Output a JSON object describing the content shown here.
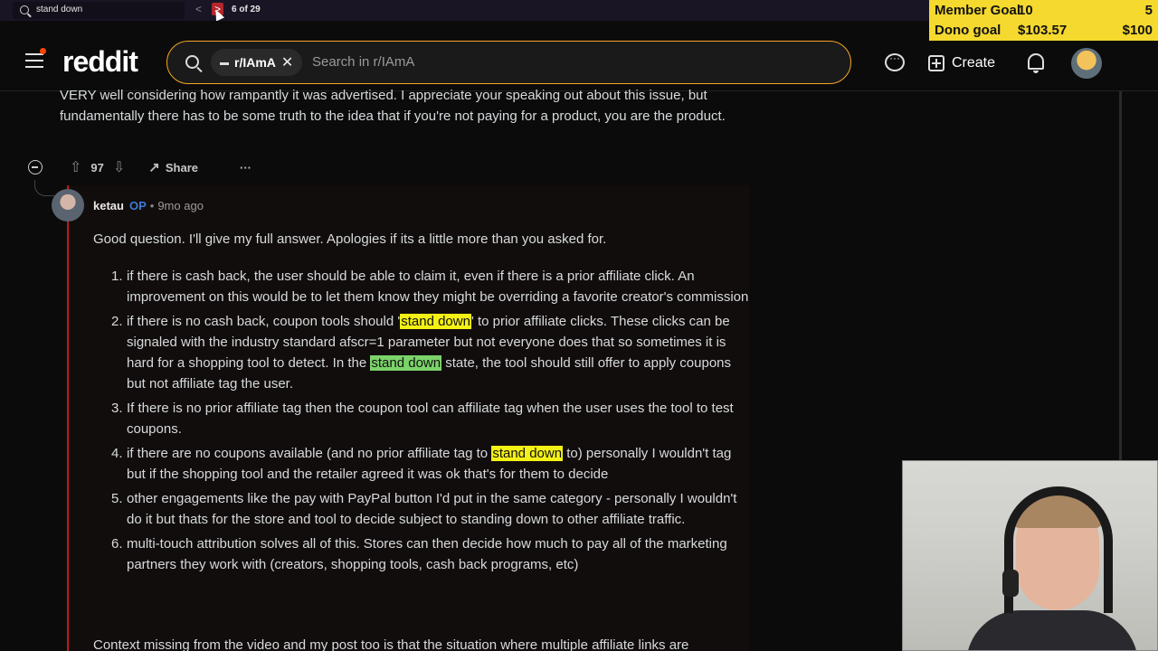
{
  "find_bar": {
    "query": "stand down",
    "prev_glyph": "<",
    "next_glyph": ">",
    "match_count": "6 of 29"
  },
  "goals": {
    "member_label": "Member Goal",
    "member_current": "10",
    "member_target": "5",
    "dono_label": "Dono goal",
    "dono_current": "$103.57",
    "dono_target": "$100",
    "color": "#f5d92e"
  },
  "header": {
    "logo": "reddit",
    "subreddit_chip": "r/IAmA",
    "chip_close": "✕",
    "search_placeholder": "Search in r/IAmA",
    "create_label": "Create",
    "accent": "#ff4500"
  },
  "previous_comment": {
    "text": "VERY well considering how rampantly it was advertised. I appreciate your speaking out about this issue, but fundamentally there has to be some truth to the idea that if you're not paying for a product, you are the product.",
    "votes": "97",
    "share_label": "Share",
    "more_label": "···"
  },
  "comment": {
    "author": "ketau",
    "op_badge": "OP",
    "separator": "•",
    "time": "9mo ago",
    "intro": "Good question. I'll give my full answer. Apologies if its a little more than you asked for.",
    "items": [
      {
        "num": "1.",
        "pre": "if there is cash back, the user should be able to claim it, even if there is a prior affiliate click. An improvement on this would be to let them know they might be overriding a favorite creator's commission"
      },
      {
        "num": "2.",
        "pre": "if there is no cash back, coupon tools should '",
        "hl1": "stand down",
        "mid": "' to prior affiliate clicks. These clicks can be signaled with the industry standard afscr=1 parameter but not everyone does that so sometimes it is hard for a shopping tool to detect. In the ",
        "hl2": "stand down",
        "post": " state, the tool should still offer to apply coupons but not affiliate tag the user."
      },
      {
        "num": "3.",
        "pre": "If there is no prior affiliate tag then the coupon tool can affiliate tag when the user uses the tool to test coupons."
      },
      {
        "num": "4.",
        "pre": "if there are no coupons available (and no prior affiliate tag to ",
        "hl1": "stand down",
        "post": " to) personally I wouldn't tag but if the shopping tool and the retailer agreed it was ok that's for them to decide"
      },
      {
        "num": "5.",
        "pre": "other engagements like the pay with PayPal button I'd put in the same category - personally I wouldn't do it but thats for the store and tool to decide subject to standing down to other affiliate traffic."
      },
      {
        "num": "6.",
        "pre": "multi-touch attribution solves all of this. Stores can then decide how much to pay all of the marketing partners they work with (creators, shopping tools, cash back programs, etc)"
      }
    ],
    "trailing": "Context missing from the video and my post too is that the situation where multiple affiliate links are"
  },
  "colors": {
    "highlight": "#f4f115",
    "highlight_current": "#7bd36a",
    "thread_accent": "#c01818",
    "op_badge": "#3a7bd5"
  }
}
